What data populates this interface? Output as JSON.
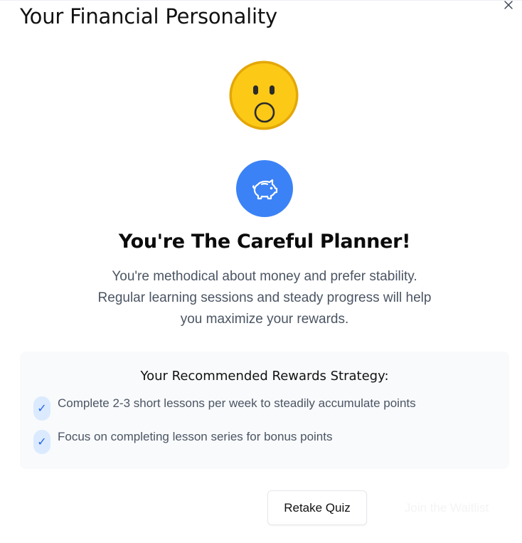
{
  "modal": {
    "title": "Your Financial Personality",
    "close_icon": "close-icon"
  },
  "result": {
    "emoji_icon": "surprised-face-icon",
    "badge_icon": "piggy-bank-icon",
    "badge_color": "#3b82f6",
    "title": "You're The Careful Planner!",
    "description_lines": [
      "You're methodical about money and prefer stability.",
      "Regular learning sessions and steady progress will help",
      "you maximize your rewards."
    ]
  },
  "strategy": {
    "heading": "Your Recommended Rewards Strategy:",
    "check_icon": "check-icon",
    "items": [
      "Complete 2-3 short lessons per week to steadily accumulate points",
      "Focus on completing lesson series for bonus points"
    ]
  },
  "actions": {
    "retake_label": "Retake Quiz",
    "waitlist_label": "Join the Waitlist"
  }
}
